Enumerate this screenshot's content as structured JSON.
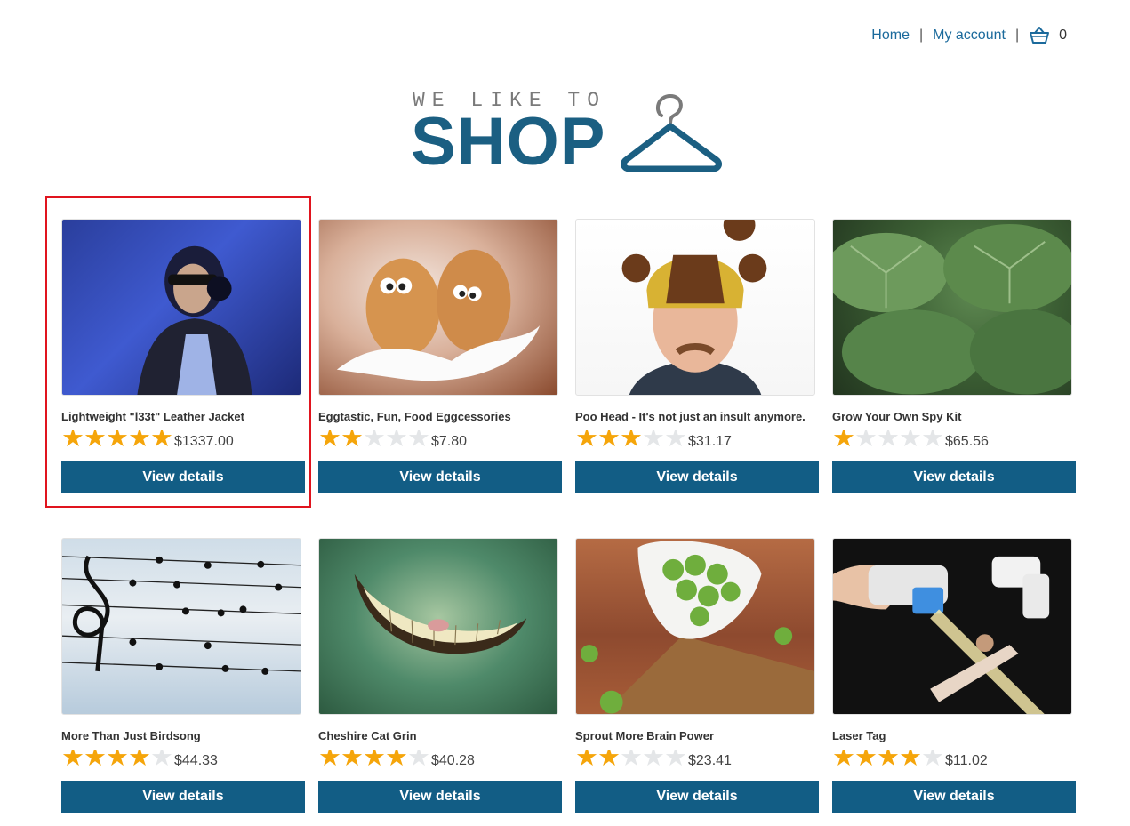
{
  "nav": {
    "home": "Home",
    "separator": "|",
    "account": "My account",
    "cart_count": "0",
    "cart_icon": "basket-icon"
  },
  "logo": {
    "small_text": "WE LIKE TO",
    "big_text": "SHOP",
    "icon": "hanger-icon",
    "color": "#1b5f82"
  },
  "colors": {
    "button": "#125d85",
    "star_filled": "#f5a50a",
    "star_empty": "#e4e6e8",
    "link": "#1b6a9c",
    "highlight": "#e0141e"
  },
  "products": [
    {
      "title": "Lightweight \"l33t\" Leather Jacket",
      "rating": 5,
      "price": "$1337.00",
      "button": "View details",
      "image": "woman-with-headphones-photo"
    },
    {
      "title": "Eggtastic, Fun, Food Eggcessories",
      "rating": 2,
      "price": "$7.80",
      "button": "View details",
      "image": "eggs-with-eyes-photo"
    },
    {
      "title": "Poo Head - It's not just an insult anymore.",
      "rating": 3,
      "price": "$31.17",
      "button": "View details",
      "image": "man-in-poo-head-hat-photo"
    },
    {
      "title": "Grow Your Own Spy Kit",
      "rating": 1,
      "price": "$65.56",
      "button": "View details",
      "image": "green-leaves-photo"
    },
    {
      "title": "More Than Just Birdsong",
      "rating": 4,
      "price": "$44.33",
      "button": "View details",
      "image": "birds-on-music-wires-photo"
    },
    {
      "title": "Cheshire Cat Grin",
      "rating": 4,
      "price": "$40.28",
      "button": "View details",
      "image": "cat-grin-photo"
    },
    {
      "title": "Sprout More Brain Power",
      "rating": 2,
      "price": "$23.41",
      "button": "View details",
      "image": "brussels-sprouts-photo"
    },
    {
      "title": "Laser Tag",
      "rating": 4,
      "price": "$11.02",
      "button": "View details",
      "image": "laser-tag-guns-photo"
    }
  ]
}
